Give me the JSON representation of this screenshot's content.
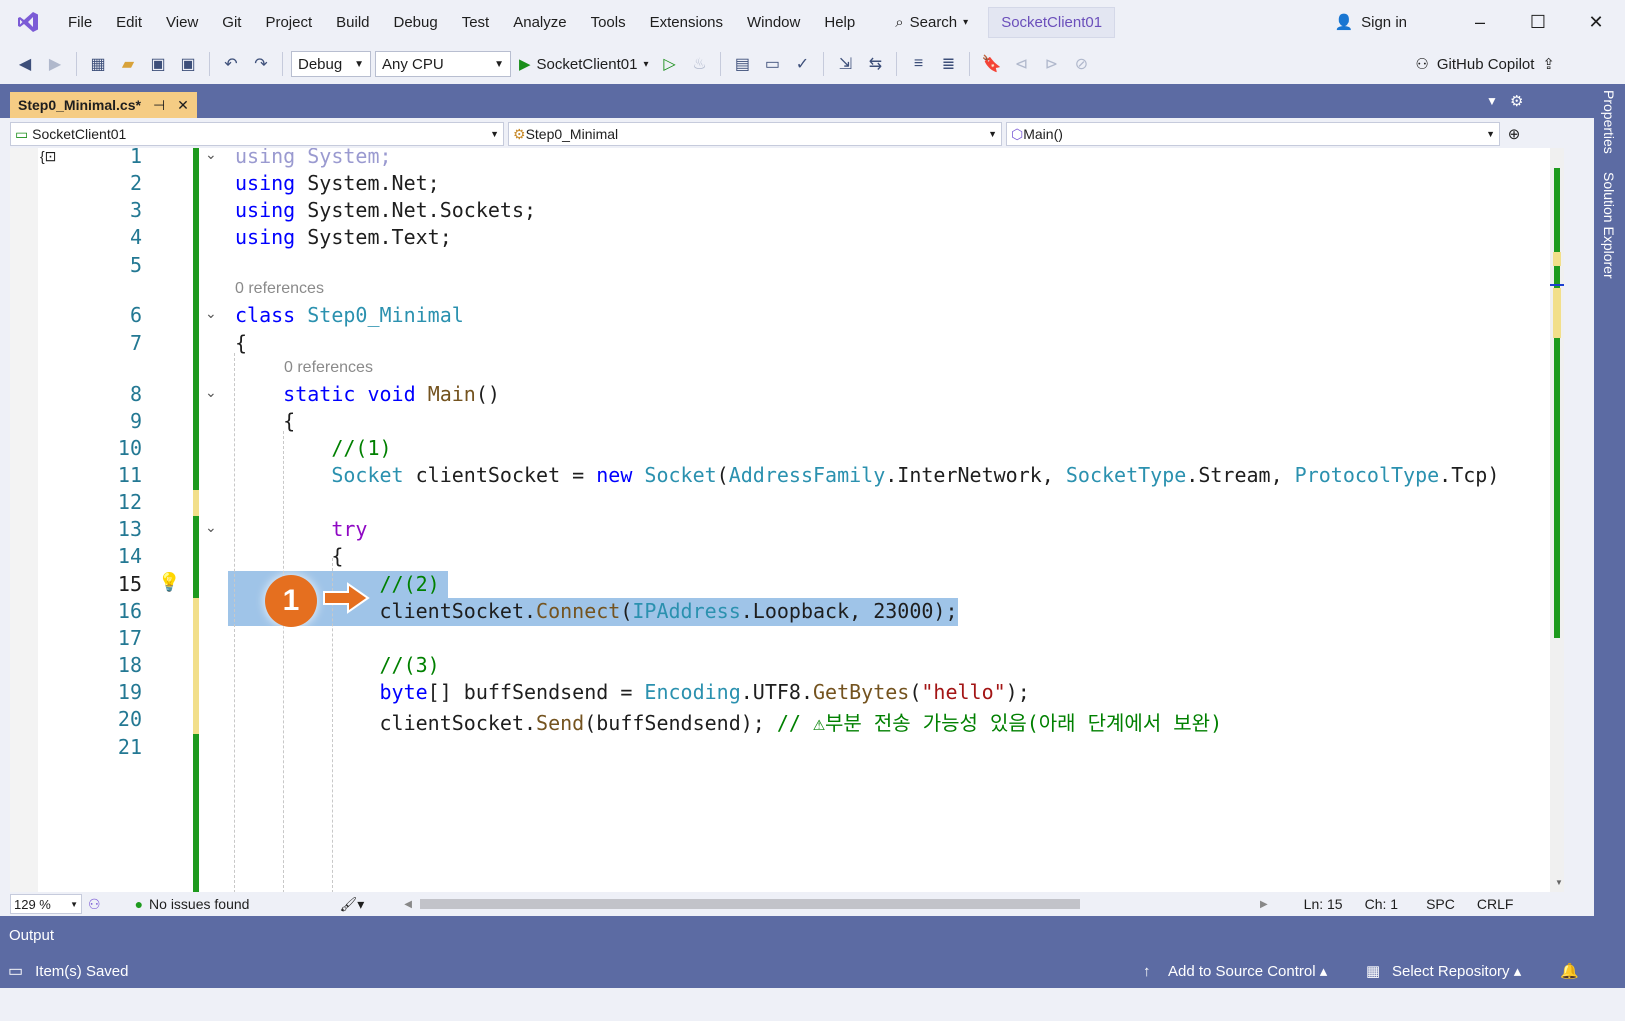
{
  "menubar": {
    "items": [
      "File",
      "Edit",
      "View",
      "Git",
      "Project",
      "Build",
      "Debug",
      "Test",
      "Analyze",
      "Tools",
      "Extensions",
      "Window",
      "Help"
    ],
    "search_label": "Search",
    "solution_title": "SocketClient01",
    "signin_label": "Sign in"
  },
  "toolbar": {
    "config": "Debug",
    "platform": "Any CPU",
    "startup": "SocketClient01",
    "copilot_label": "GitHub Copilot"
  },
  "tab": {
    "label": "Step0_Minimal.cs*"
  },
  "navbar": {
    "project": "SocketClient01",
    "class": "Step0_Minimal",
    "member": "Main()"
  },
  "editor": {
    "codelens": "0 references",
    "lines": [
      {
        "n": "1",
        "code": "using System;"
      },
      {
        "n": "2",
        "code": "using System.Net;"
      },
      {
        "n": "3",
        "code": "using System.Net.Sockets;"
      },
      {
        "n": "4",
        "code": "using System.Text;"
      },
      {
        "n": "5",
        "code": ""
      },
      {
        "n": "6",
        "code": "class Step0_Minimal"
      },
      {
        "n": "7",
        "code": "{"
      },
      {
        "n": "8",
        "code": "static void Main()"
      },
      {
        "n": "9",
        "code": "{"
      },
      {
        "n": "10",
        "code": "//(1)"
      },
      {
        "n": "11",
        "code": "Socket clientSocket = new Socket(AddressFamily.InterNetwork, SocketType.Stream, ProtocolType.Tcp)"
      },
      {
        "n": "12",
        "code": ""
      },
      {
        "n": "13",
        "code": "try"
      },
      {
        "n": "14",
        "code": "{"
      },
      {
        "n": "15",
        "code": "//(2)"
      },
      {
        "n": "16",
        "code": "clientSocket.Connect(IPAddress.Loopback, 23000);"
      },
      {
        "n": "17",
        "code": ""
      },
      {
        "n": "18",
        "code": "//(3)"
      },
      {
        "n": "19",
        "code": "byte[] buffSendsend = Encoding.UTF8.GetBytes(\"hello\");"
      },
      {
        "n": "20",
        "code": "clientSocket.Send(buffSendsend); // ⚠부분 전송 가능성 있음(아래 단계에서 보완)"
      },
      {
        "n": "21",
        "code": ""
      }
    ],
    "callout_number": "1",
    "zoom": "129 %",
    "issues": "No issues found",
    "ln": "Ln: 15",
    "ch": "Ch: 1",
    "spc": "SPC",
    "crlf": "CRLF"
  },
  "rail": {
    "properties": "Properties",
    "solution_explorer": "Solution Explorer"
  },
  "output": {
    "label": "Output"
  },
  "status": {
    "saved": "Item(s) Saved",
    "source_control": "Add to Source Control",
    "repository": "Select Repository"
  }
}
